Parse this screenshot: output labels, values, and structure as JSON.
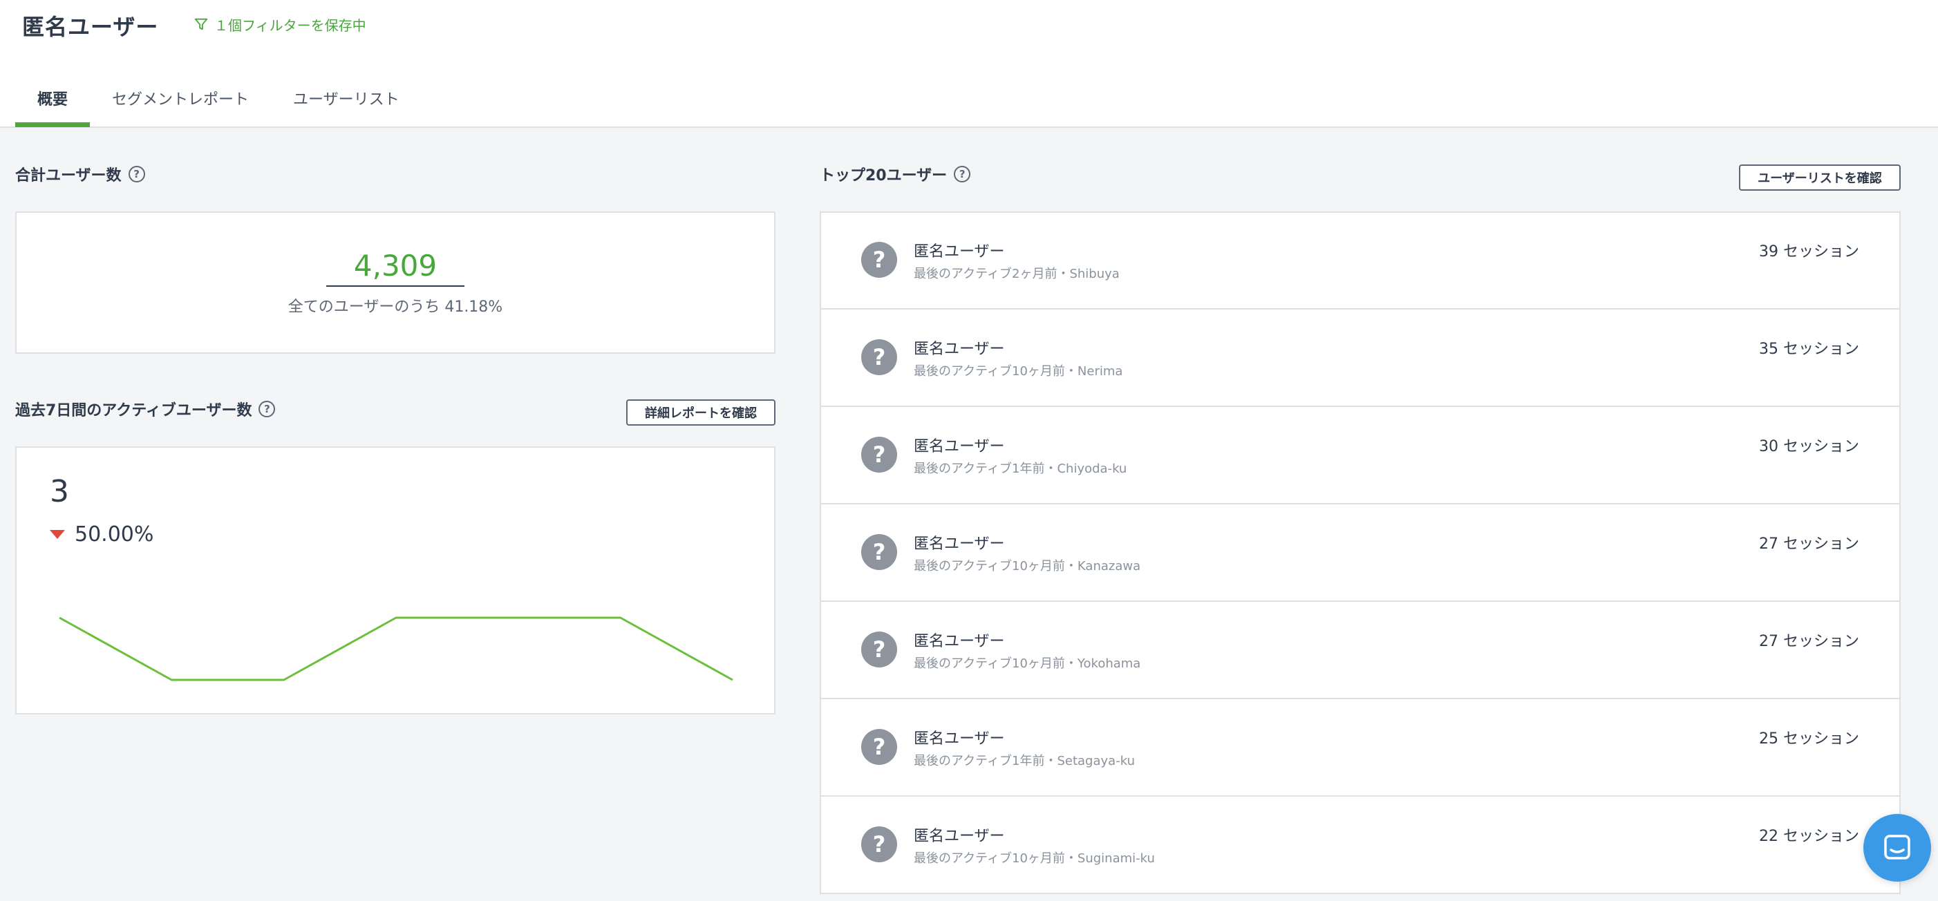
{
  "header": {
    "title": "匿名ユーザー",
    "filter_label": "１個フィルターを保存中"
  },
  "tabs": [
    {
      "label": "概要",
      "active": true
    },
    {
      "label": "セグメントレポート",
      "active": false
    },
    {
      "label": "ユーザーリスト",
      "active": false
    }
  ],
  "total_users": {
    "title": "合計ユーザー数",
    "value": "4,309",
    "subtitle": "全てのユーザーのうち 41.18%"
  },
  "active_users": {
    "title": "過去7日間のアクティブユーザー数",
    "button_label": "詳細レポートを確認",
    "value": "3",
    "change": "50.00%",
    "trend": "down",
    "line_color": "#6cbf3a",
    "trend_color": "#e04a3b"
  },
  "sparkline_data": {
    "type": "line",
    "values": [
      2,
      1,
      1,
      2,
      2,
      2,
      1
    ],
    "ylim": [
      1,
      2
    ]
  },
  "top_users": {
    "title": "トップ20ユーザー",
    "button_label": "ユーザーリストを確認",
    "users": [
      {
        "name": "匿名ユーザー",
        "meta": "最後のアクティブ2ヶ月前・Shibuya",
        "sessions": "39 セッション"
      },
      {
        "name": "匿名ユーザー",
        "meta": "最後のアクティブ10ヶ月前・Nerima",
        "sessions": "35 セッション"
      },
      {
        "name": "匿名ユーザー",
        "meta": "最後のアクティブ1年前・Chiyoda-ku",
        "sessions": "30 セッション"
      },
      {
        "name": "匿名ユーザー",
        "meta": "最後のアクティブ10ヶ月前・Kanazawa",
        "sessions": "27 セッション"
      },
      {
        "name": "匿名ユーザー",
        "meta": "最後のアクティブ10ヶ月前・Yokohama",
        "sessions": "27 セッション"
      },
      {
        "name": "匿名ユーザー",
        "meta": "最後のアクティブ1年前・Setagaya-ku",
        "sessions": "25 セッション"
      },
      {
        "name": "匿名ユーザー",
        "meta": "最後のアクティブ10ヶ月前・Suginami-ku",
        "sessions": "22 セッション"
      }
    ]
  },
  "colors": {
    "accent_green": "#4ca83a",
    "avatar_gray": "#8e949e",
    "chat_blue": "#3a9ae8"
  },
  "icons": {
    "filter": "filter-icon",
    "help": "help-icon",
    "avatar": "question-mark-avatar-icon",
    "chat": "chat-icon"
  }
}
